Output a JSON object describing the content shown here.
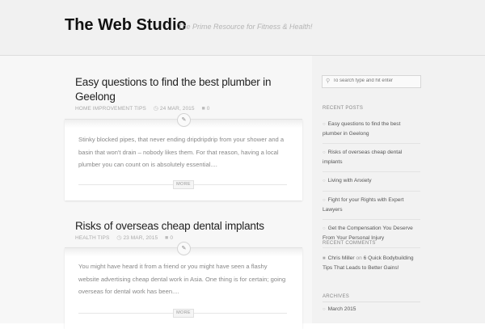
{
  "header": {
    "site_title": "The Web Studio",
    "tagline": "The Prime Resource for Fitness & Health!"
  },
  "posts": [
    {
      "title": "Easy questions to find the best plumber in Geelong",
      "category": "HOME IMPROVEMENT TIPS",
      "date": "24 MAR, 2015",
      "comments": "0",
      "excerpt": "Stinky blocked pipes, that never ending dripdripdrip from your shower and a basin that won't drain – nobody likes them. For that reason, having a local plumber you can count on is absolutely essential....",
      "more": "MORE"
    },
    {
      "title": "Risks of overseas cheap dental implants",
      "category": "HEALTH TIPS",
      "date": "23 MAR, 2015",
      "comments": "0",
      "excerpt": "You might have heard it from a friend or you might have seen a flashy website advertising cheap dental work in Asia. One thing is for certain; going overseas for dental work has been....",
      "more": "MORE"
    }
  ],
  "sidebar": {
    "search": {
      "placeholder": "To search type and hit enter"
    },
    "recent_posts": {
      "title": "RECENT POSTS",
      "items": [
        "Easy questions to find the best plumber in Geelong",
        "Risks of overseas cheap dental implants",
        "Living with Anxiety",
        "Fight for your Rights with Expert Lawyers",
        "Get the Compensation You Deserve From Your Personal Injury"
      ]
    },
    "recent_comments": {
      "title": "RECENT COMMENTS",
      "author": "Chris Miller",
      "on": "on",
      "post": "6 Quick Bodybuilding Tips That Leads to Better Gains!"
    },
    "archives": {
      "title": "ARCHIVES",
      "items": [
        "March 2015"
      ]
    }
  },
  "icons": {
    "clock": "clock-icon",
    "comment": "comment-bubble-icon",
    "pencil": "pencil-icon",
    "search": "search-icon"
  },
  "colors": {
    "header_bg": "#f1f1f1",
    "content_bg": "#f7f7f7",
    "sidebar_bg": "#f2f2f2",
    "title_text": "#111111"
  }
}
